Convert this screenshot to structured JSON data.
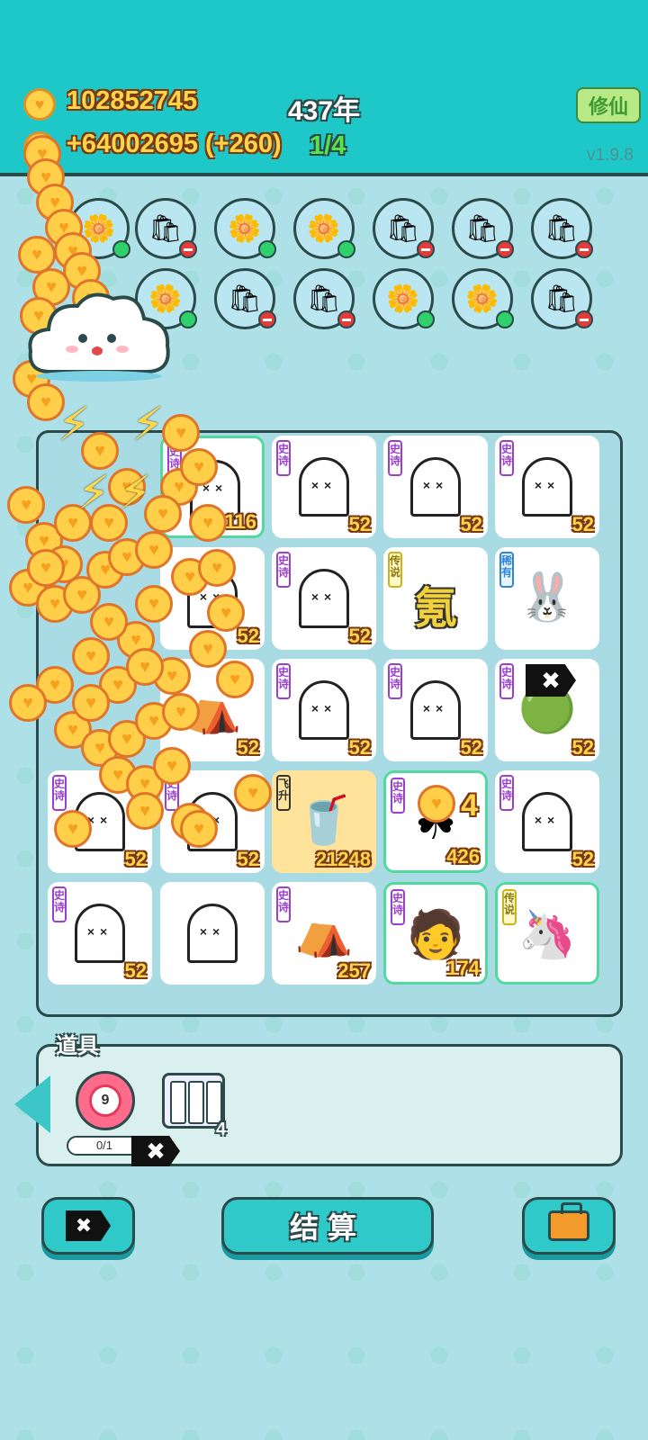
{
  "header": {
    "coins": "102852745",
    "income": "+64002695 (+260)",
    "years": "437年",
    "progress": "1/4",
    "cultivate_button": "修仙",
    "version": "v1.9.8"
  },
  "pots_top": [
    [
      "flower-icon",
      "bag-icon",
      "flower-icon",
      "flower-icon",
      "bag-icon",
      "bag-icon",
      "bag-icon"
    ],
    [
      "flower-icon",
      "bag-icon",
      "bag-icon",
      "flower-icon",
      "flower-icon",
      "bag-icon"
    ]
  ],
  "board": {
    "cells": [
      {
        "tag": "史诗",
        "icon": "ghost-icon",
        "value": "116"
      },
      {
        "tag": "史诗",
        "icon": "ghost-icon",
        "value": "52"
      },
      {
        "tag": "史诗",
        "icon": "ghost-icon",
        "value": "52"
      },
      {
        "tag": "史诗",
        "icon": "ghost-icon",
        "value": "52"
      },
      {
        "tag": "",
        "icon": "ghost-icon",
        "value": "52"
      },
      {
        "tag": "史诗",
        "icon": "ghost-icon",
        "value": "52"
      },
      {
        "tag": "传说",
        "icon": "glyph",
        "glyph": "氪",
        "value": ""
      },
      {
        "tag": "稀有",
        "icon": "rabbit-icon",
        "value": ""
      },
      {
        "tag": "",
        "icon": "tent-icon",
        "value": "52"
      },
      {
        "tag": "史诗",
        "icon": "ghost-icon",
        "value": "52"
      },
      {
        "tag": "史诗",
        "icon": "ghost-icon",
        "value": "52"
      },
      {
        "tag": "史诗",
        "icon": "slime-icon",
        "value": "52"
      },
      {
        "tag": "史诗",
        "icon": "ghost-icon",
        "value": "52"
      },
      {
        "tag": "史诗",
        "icon": "ghost-icon",
        "value": "52"
      },
      {
        "tag": "飞升",
        "icon": "cup-icon",
        "value": "21248"
      },
      {
        "tag": "史诗",
        "icon": "clover-icon",
        "value": "426",
        "overlay": "4"
      },
      {
        "tag": "史诗",
        "icon": "ghost-icon",
        "value": "52"
      },
      {
        "tag": "史诗",
        "icon": "ghost-icon",
        "value": "52"
      },
      {
        "tag": "",
        "icon": "ghost-icon",
        "value": ""
      },
      {
        "tag": "史诗",
        "icon": "tent-icon",
        "value": "257"
      },
      {
        "tag": "史诗",
        "icon": "face-icon",
        "value": "174"
      },
      {
        "tag": "传说",
        "icon": "unicorn-icon",
        "value": ""
      }
    ]
  },
  "tools": {
    "label": "道具",
    "target_count": "9",
    "target_progress": "0/1",
    "tubes_count": "4"
  },
  "bottom": {
    "settle_label": "结算"
  }
}
